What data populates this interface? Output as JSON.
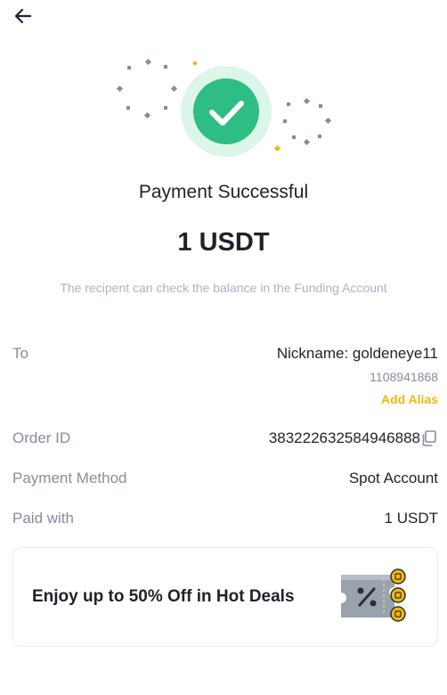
{
  "header": {
    "back_icon": "arrow-left-icon"
  },
  "status": {
    "icon": "check-circle-icon",
    "accent_color": "#2ebd85",
    "title": "Payment Successful",
    "amount": "1 USDT",
    "subtitle": "The recipent can check the balance in the Funding Account"
  },
  "details": {
    "to": {
      "label": "To",
      "nickname": "Nickname: goldeneye11",
      "user_id": "1108941868",
      "add_alias": "Add Alias"
    },
    "order": {
      "label": "Order ID",
      "value": "383222632584946888",
      "copy_icon": "copy-icon"
    },
    "payment_method": {
      "label": "Payment Method",
      "value": "Spot Account"
    },
    "paid_with": {
      "label": "Paid with",
      "value": "1 USDT"
    }
  },
  "promo": {
    "text": "Enjoy up to 50% Off in Hot Deals",
    "icon": "discount-ticket-icon"
  },
  "colors": {
    "brand_yellow": "#f0b90b",
    "success_green": "#2ebd85",
    "text_primary": "#1e2329",
    "text_secondary": "#848e9c"
  }
}
